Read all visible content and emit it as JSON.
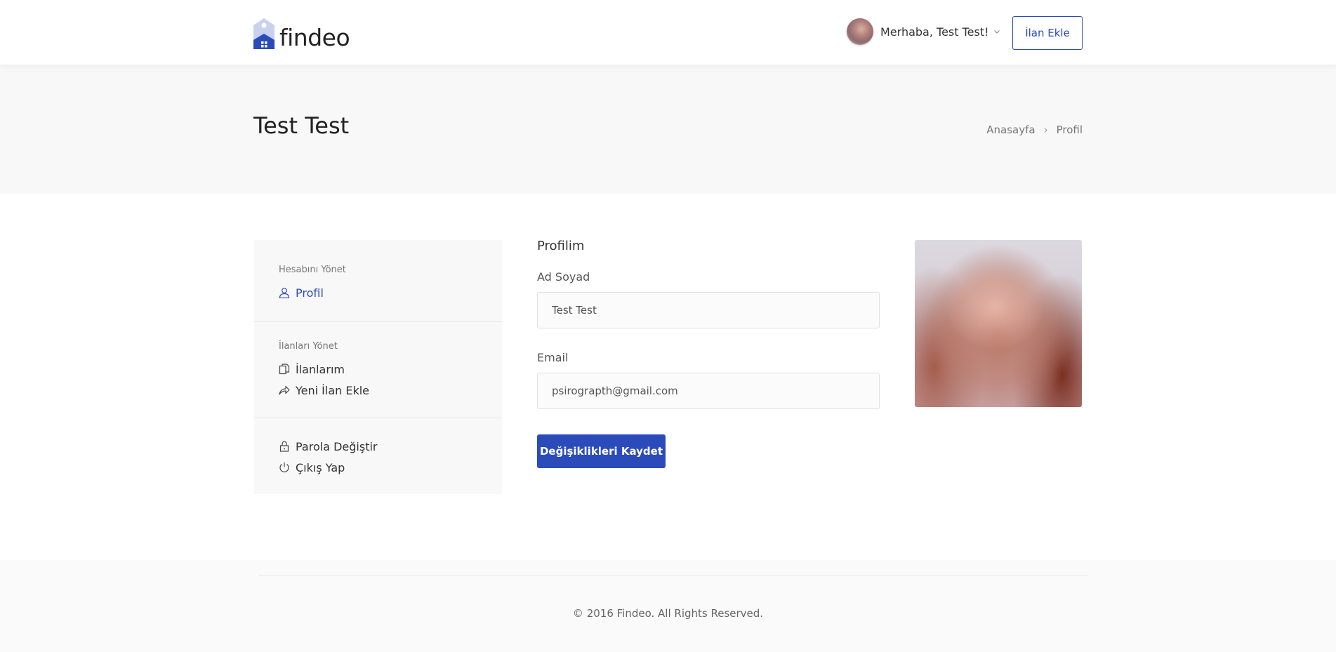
{
  "header": {
    "logo_text": "findeo",
    "greeting": "Merhaba, Test Test!",
    "add_button": "İlan Ekle"
  },
  "titlebar": {
    "title": "Test Test",
    "breadcrumb": [
      "Anasayfa",
      "Profil"
    ]
  },
  "sidebar": {
    "groups": [
      {
        "heading": "Hesabını Yönet",
        "items": [
          {
            "label": "Profil",
            "icon": "user-icon",
            "active": true
          }
        ]
      },
      {
        "heading": "İlanları Yönet",
        "items": [
          {
            "label": "İlanlarım",
            "icon": "copy-icon"
          },
          {
            "label": "Yeni İlan Ekle",
            "icon": "share-arrow-icon"
          }
        ]
      },
      {
        "heading": "",
        "items": [
          {
            "label": "Parola Değiştir",
            "icon": "lock-icon"
          },
          {
            "label": "Çıkış Yap",
            "icon": "power-icon"
          }
        ]
      }
    ]
  },
  "form": {
    "title": "Profilim",
    "name_label": "Ad Soyad",
    "name_value": "Test Test",
    "email_label": "Email",
    "email_value": "psirograpth@gmail.com",
    "save_button": "Değişiklikleri Kaydet"
  },
  "footer": {
    "copyright": "© 2016 Findeo. All Rights Reserved."
  },
  "colors": {
    "accent": "#2a4bb9",
    "titlebar_bg": "#f8f8f8",
    "sidebar_bg": "#f8f8f8"
  }
}
